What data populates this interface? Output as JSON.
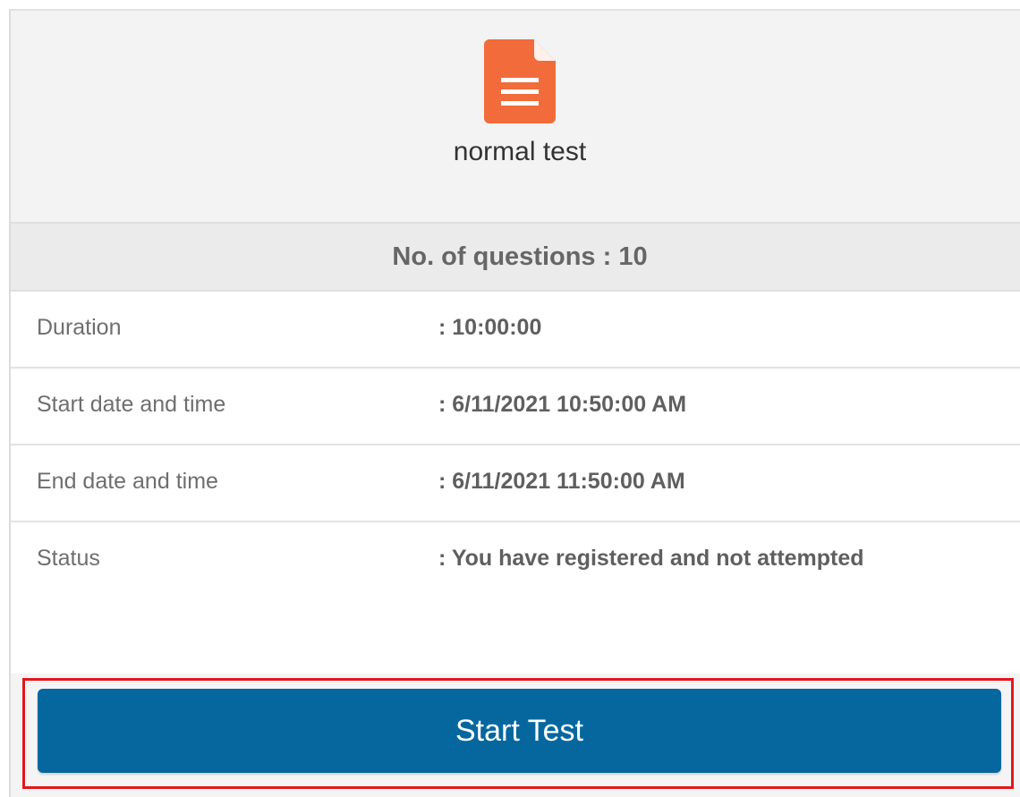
{
  "test": {
    "title": "normal test",
    "icon": "document-icon",
    "icon_color": "#f26b3a"
  },
  "questions_label": "No. of questions : 10",
  "details": [
    {
      "label": "Duration",
      "value": ": 10:00:00"
    },
    {
      "label": "Start date and time",
      "value": ": 6/11/2021 10:50:00 AM"
    },
    {
      "label": "End date and time",
      "value": ": 6/11/2021 11:50:00 AM"
    },
    {
      "label": "Status",
      "value": ":  You have registered and not attempted"
    }
  ],
  "start_button": {
    "label": "Start Test",
    "color": "#06679f"
  },
  "highlight_color": "#e3161c"
}
